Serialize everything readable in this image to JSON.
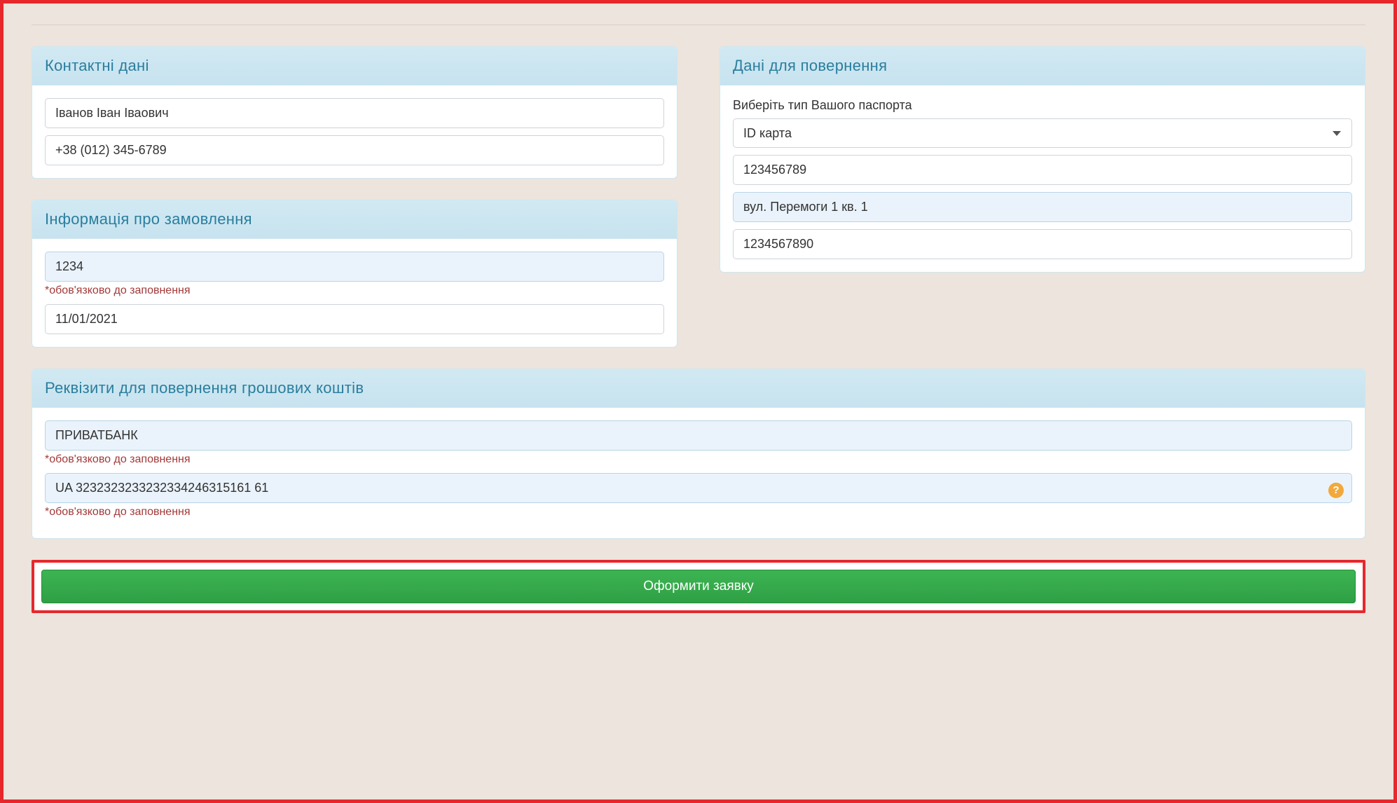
{
  "contact": {
    "title": "Контактні дані",
    "name": "Іванов Іван Іваович",
    "phone": "+38 (012) 345-6789"
  },
  "return_data": {
    "title": "Дані для повернення",
    "passport_label": "Виберіть тип Вашого паспорта",
    "passport_type_selected": "ID карта",
    "passport_number": "123456789",
    "address": "вул. Перемоги 1 кв. 1",
    "inn": "1234567890"
  },
  "order_info": {
    "title": "Інформація про замовлення",
    "order_number": "1234",
    "required_hint": "*обов'язково до заповнення",
    "date": "11/01/2021"
  },
  "bank_details": {
    "title": "Реквізити для повернення грошових коштів",
    "bank_name": "ПРИВАТБАНК",
    "required_hint1": "*обов'язково до заповнення",
    "iban": "UA 3232323233232334246315161 61",
    "required_hint2": "*обов'язково до заповнення",
    "help_icon": "?"
  },
  "submit": {
    "label": "Оформити заявку"
  }
}
